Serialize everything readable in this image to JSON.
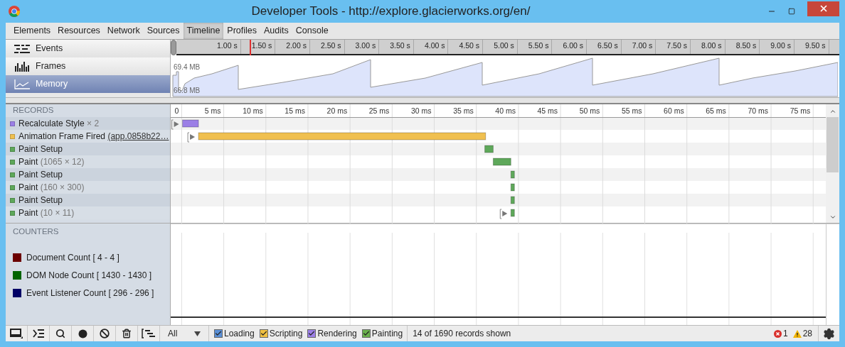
{
  "window": {
    "title": "Developer Tools - http://explore.glacierworks.org/en/"
  },
  "tabs": [
    {
      "label": "Elements",
      "selected": false
    },
    {
      "label": "Resources",
      "selected": false
    },
    {
      "label": "Network",
      "selected": false
    },
    {
      "label": "Sources",
      "selected": false
    },
    {
      "label": "Timeline",
      "selected": true
    },
    {
      "label": "Profiles",
      "selected": false
    },
    {
      "label": "Audits",
      "selected": false
    },
    {
      "label": "Console",
      "selected": false
    }
  ],
  "overview": {
    "modes": [
      {
        "kind": "events",
        "label": "Events",
        "selected": false
      },
      {
        "kind": "frames",
        "label": "Frames",
        "selected": false
      },
      {
        "kind": "memory",
        "label": "Memory",
        "selected": true
      }
    ],
    "ruler": [
      "1.00 s",
      "1.50 s",
      "2.00 s",
      "2.50 s",
      "3.00 s",
      "3.50 s",
      "4.00 s",
      "4.50 s",
      "5.00 s",
      "5.50 s",
      "6.00 s",
      "6.50 s",
      "7.00 s",
      "7.50 s",
      "8.00 s",
      "8.50 s",
      "9.00 s",
      "9.50 s"
    ],
    "memory_max": "69.4 MB",
    "memory_min": "66.8 MB"
  },
  "records": {
    "header": "RECORDS",
    "rows": [
      {
        "name": "Recalculate Style",
        "detail": "× 2",
        "kind": "plain",
        "color": "#9b7fe6",
        "expandable": true
      },
      {
        "name": "Animation Frame Fired",
        "detail": "(app.0858b22…",
        "kind": "link",
        "color": "#f0c050",
        "expandable": true
      },
      {
        "name": "Paint Setup",
        "color": "#5ea85a",
        "expandable": false
      },
      {
        "name": "Paint",
        "detail": "(1065 × 12)",
        "kind": "plain",
        "color": "#5ea85a",
        "expandable": false
      },
      {
        "name": "Paint Setup",
        "color": "#5ea85a",
        "expandable": false
      },
      {
        "name": "Paint",
        "detail": "(160 × 300)",
        "kind": "plain",
        "color": "#5ea85a",
        "expandable": false
      },
      {
        "name": "Paint Setup",
        "color": "#5ea85a",
        "expandable": false
      },
      {
        "name": "Paint",
        "detail": "(10 × 11)",
        "kind": "plain",
        "color": "#5ea85a",
        "expandable": true
      }
    ],
    "ruler": [
      "0",
      "5 ms",
      "10 ms",
      "15 ms",
      "20 ms",
      "25 ms",
      "30 ms",
      "35 ms",
      "40 ms",
      "45 ms",
      "50 ms",
      "55 ms",
      "60 ms",
      "65 ms",
      "70 ms",
      "75 ms"
    ]
  },
  "counters": {
    "header": "COUNTERS",
    "items": [
      {
        "label": "Document Count [ 4 - 4 ]",
        "color": "#6b0000"
      },
      {
        "label": "DOM Node Count [ 1430 - 1430 ]",
        "color": "#006400"
      },
      {
        "label": "Event Listener Count [ 296 - 296 ]",
        "color": "#000066"
      }
    ]
  },
  "toolbar": {
    "filter": "All",
    "categories": [
      {
        "label": "Loading",
        "checked": true,
        "color": "#5a8fd6"
      },
      {
        "label": "Scripting",
        "checked": true,
        "color": "#f0c040"
      },
      {
        "label": "Rendering",
        "checked": true,
        "color": "#9b7fe6"
      },
      {
        "label": "Painting",
        "checked": true,
        "color": "#6ab04c"
      }
    ],
    "status": "14 of 1690 records shown",
    "errors": "1",
    "warnings": "28"
  }
}
